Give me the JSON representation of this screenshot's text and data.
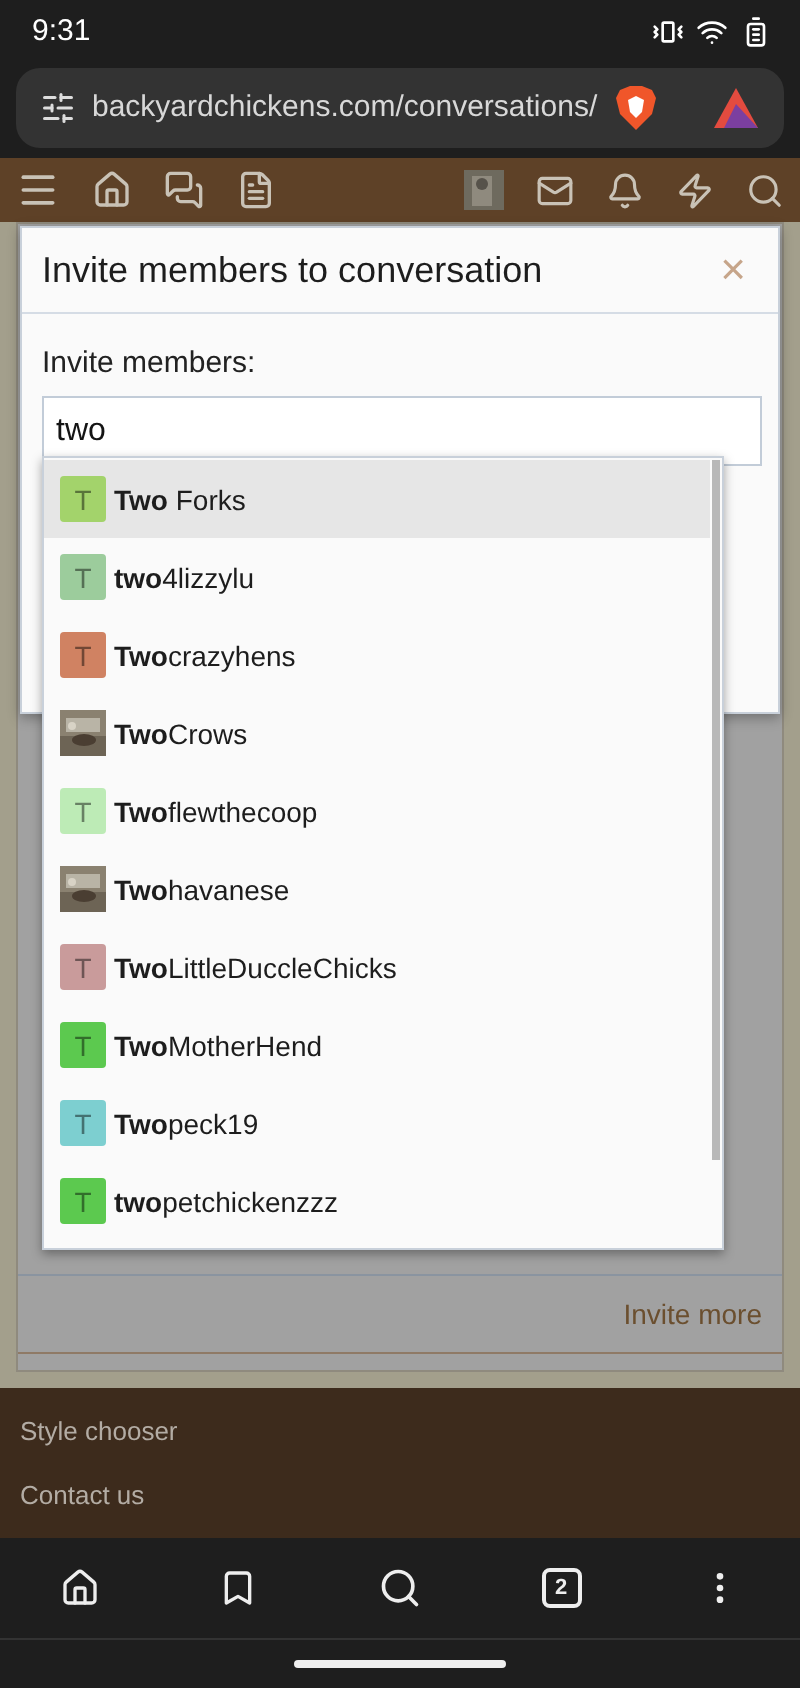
{
  "status_bar": {
    "time": "9:31"
  },
  "browser": {
    "url": "backyardchickens.com/conversations/",
    "tab_count": "2"
  },
  "modal": {
    "title": "Invite members to conversation",
    "close": "×",
    "field_label": "Invite members:",
    "field_value": "two"
  },
  "suggestions": [
    {
      "kind": "letter",
      "letter": "T",
      "color": "#a3d36b",
      "name": "**Two** Forks",
      "selected": true
    },
    {
      "kind": "letter",
      "letter": "T",
      "color": "#9ccc9c",
      "name": "**two**4lizzylu",
      "selected": false
    },
    {
      "kind": "letter",
      "letter": "T",
      "color": "#d08262",
      "name": "**Two**crazyhens",
      "selected": false
    },
    {
      "kind": "picture",
      "name": "**Two**Crows",
      "selected": false
    },
    {
      "kind": "letter",
      "letter": "T",
      "color": "#bdebb6",
      "name": "**Two**flewthecoop",
      "selected": false
    },
    {
      "kind": "picture",
      "name": "**Two**havanese",
      "selected": false
    },
    {
      "kind": "letter",
      "letter": "T",
      "color": "#c99b9b",
      "name": "**Two**LittleDuccleChicks",
      "selected": false
    },
    {
      "kind": "letter",
      "letter": "T",
      "color": "#5cc94f",
      "name": "**Two**MotherHend",
      "selected": false
    },
    {
      "kind": "letter",
      "letter": "T",
      "color": "#7dcfd0",
      "name": "**Two**peck19",
      "selected": false
    },
    {
      "kind": "letter",
      "letter": "T",
      "color": "#5cc94f",
      "name": "**two**petchickenzzz",
      "selected": false
    }
  ],
  "panel": {
    "link": "Invite more"
  },
  "footer": [
    "Style chooser",
    "Contact us"
  ]
}
